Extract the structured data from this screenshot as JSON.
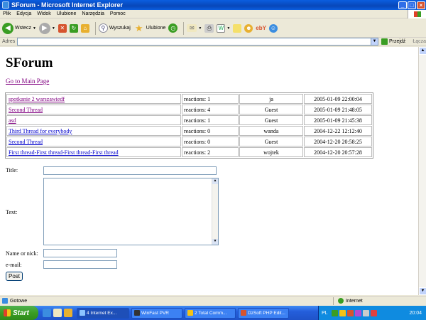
{
  "window": {
    "title": "SForum - Microsoft Internet Explorer"
  },
  "menu": [
    "Plik",
    "Edycja",
    "Widok",
    "Ulubione",
    "Narzędzia",
    "Pomoc"
  ],
  "toolbar": {
    "back_label": "Wstecz",
    "search_label": "Wyszukaj",
    "favorites_label": "Ulubione"
  },
  "address": {
    "label": "Adres",
    "value": "",
    "go_label": "Przejdź",
    "links_label": "Łącza"
  },
  "page": {
    "title": "SForum",
    "main_link": "Go to Main Page",
    "threads": [
      {
        "title": "spotkanie 2 warszawiedf",
        "reactions": "reactions: 1",
        "author": "ja",
        "date": "2005-01-09 22:00:04",
        "visited": true
      },
      {
        "title": "Second Thread",
        "reactions": "reactions: 4",
        "author": "Guest",
        "date": "2005-01-09 21:48:05",
        "visited": true
      },
      {
        "title": "asd",
        "reactions": "reactions: 1",
        "author": "Guest",
        "date": "2005-01-09 21:45:38",
        "visited": true
      },
      {
        "title": "Third Thread for everybody",
        "reactions": "reactions: 0",
        "author": "wanda",
        "date": "2004-12-22 12:12:40",
        "visited": false
      },
      {
        "title": "Second Thread",
        "reactions": "reactions: 0",
        "author": "Guest",
        "date": "2004-12-20 20:58:25",
        "visited": false
      },
      {
        "title": "First thread-First thread-First thread-First thread",
        "reactions": "reactions: 2",
        "author": "wojtek",
        "date": "2004-12-20 20:57:28",
        "visited": false
      }
    ],
    "form": {
      "title_label": "Title:",
      "title_value": "",
      "text_label": "Text:",
      "text_value": "",
      "name_label": "Name or nick:",
      "name_value": "",
      "email_label": "e-mail:",
      "email_value": "",
      "post_label": "Post"
    }
  },
  "status": {
    "left": "Gotowe",
    "zone": "Internet"
  },
  "taskbar": {
    "start_label": "Start",
    "tasks": [
      "4 Internet Ex...",
      "WinFast PVR",
      "2 Total Comm...",
      "DzSoft PHP Edit..."
    ],
    "language": "PL",
    "clock": "20:04"
  }
}
